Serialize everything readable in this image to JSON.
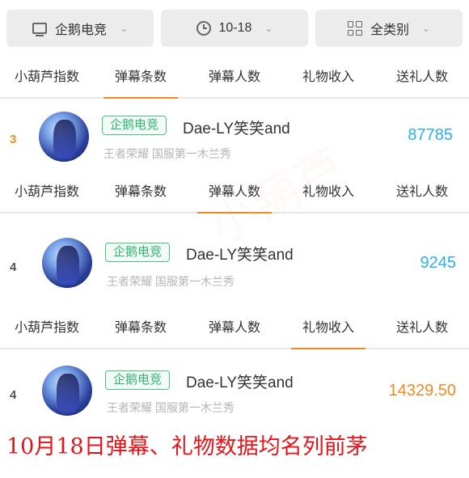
{
  "filters": {
    "category": "企鹅电竞",
    "date": "10-18",
    "type": "全类别"
  },
  "tabs": [
    "小葫芦指数",
    "弹幕条数",
    "弹幕人数",
    "礼物收入",
    "送礼人数"
  ],
  "rows": [
    {
      "rank": "3",
      "rank_color": "#f08a24",
      "platform": "企鹅电竞",
      "name": "Dae-LY笑笑and",
      "subtitle": "王者荣耀 国服第一木兰秀",
      "value": "87785",
      "value_color": "#2ab0ec"
    },
    {
      "rank": "4",
      "rank_color": "#555555",
      "platform": "企鹅电竞",
      "name": "Dae-LY笑笑and",
      "subtitle": "王者荣耀 国服第一木兰秀",
      "value": "9245",
      "value_color": "#2ab0ec"
    },
    {
      "rank": "4",
      "rank_color": "#555555",
      "platform": "企鹅电竞",
      "name": "Dae-LY笑笑and",
      "subtitle": "王者荣耀 国服第一木兰秀",
      "value": "14329.50",
      "value_color": "#f08a24"
    }
  ],
  "tab_groups_active": [
    "弹幕条数",
    "弹幕人数",
    "礼物收入"
  ],
  "caption": "10月18日弹幕、礼物数据均名列前茅"
}
